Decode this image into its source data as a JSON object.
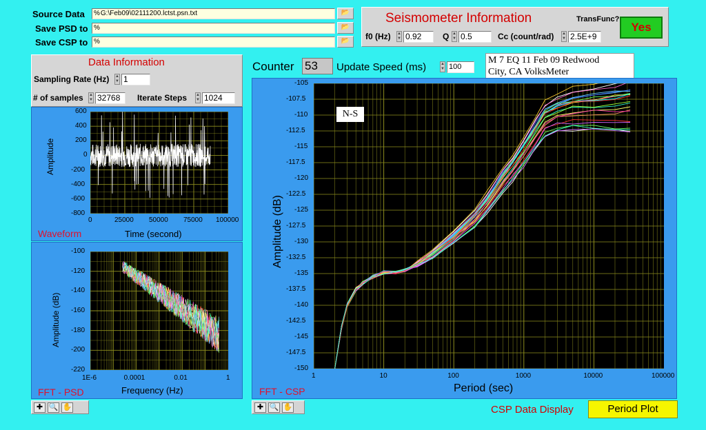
{
  "files": {
    "source": {
      "label": "Source Data",
      "value": "G:\\Feb09\\02111200.lctst.psn.txt"
    },
    "psd": {
      "label": "Save PSD to",
      "value": ""
    },
    "csp": {
      "label": "Save CSP to",
      "value": ""
    },
    "path_glyph": "%"
  },
  "seismometer": {
    "title": "Seismometer Information",
    "transfunc_label": "TransFunc?",
    "transfunc_value": "Yes",
    "f0_label": "f0 (Hz)",
    "f0_value": "0.92",
    "q_label": "Q",
    "q_value": "0.5",
    "cc_label": "Cc (count/rad)",
    "cc_value": "2.5E+9"
  },
  "data_info": {
    "title": "Data Information",
    "sampling_rate_label": "Sampling Rate (Hz)",
    "sampling_rate_value": "1",
    "samples_label": "# of samples",
    "samples_value": "32768",
    "iterate_label": "Iterate Steps",
    "iterate_value": "1024"
  },
  "counter": {
    "label": "Counter",
    "value": "53"
  },
  "update_speed": {
    "label": "Update Speed (ms)",
    "value": "100"
  },
  "event_note": {
    "line1": "M 7 EQ 11 Feb 09 Redwood",
    "line2": "City, CA VolksMeter"
  },
  "colors": {
    "accent_red": "#d40000",
    "chart_panel": "#3a9bee",
    "grid": "#8f8f1e",
    "trace": "#ffffff",
    "background": "#33f0f0",
    "yes_green": "#22cc22"
  },
  "bottom": {
    "csp_label": "CSP Data Display",
    "period_plot": "Period Plot"
  },
  "icons": [
    "folder-icon",
    "crosshair-icon",
    "zoom-icon",
    "hand-icon"
  ],
  "chart_data": [
    {
      "type": "line",
      "tag": "Waveform",
      "xlabel": "Time (second)",
      "ylabel": "Amplitude",
      "xlim": [
        0,
        100000
      ],
      "ylim": [
        -800,
        600
      ],
      "xticks": [
        "0",
        "25000",
        "50000",
        "75000",
        "100000"
      ],
      "yticks": [
        "600",
        "400",
        "200",
        "0",
        "-200",
        "-400",
        "-600",
        "-800"
      ],
      "x_data_extent": [
        0,
        87000
      ],
      "series": [
        {
          "values_note_range": [
            -300,
            300
          ]
        }
      ],
      "grid": true
    },
    {
      "type": "line",
      "tag": "FFT - PSD",
      "xlabel": "Frequency (Hz)",
      "ylabel": "Amplitude (dB)",
      "xscale": "log",
      "xlim": [
        1e-06,
        1
      ],
      "ylim": [
        -220,
        -100
      ],
      "xticks": [
        "1E-6",
        "0.0001",
        "0.01",
        "1"
      ],
      "yticks": [
        "-100",
        "-120",
        "-140",
        "-160",
        "-180",
        "-200",
        "-220"
      ],
      "grid": true
    },
    {
      "type": "line",
      "tag": "FFT - CSP",
      "annotation": "N-S",
      "xlabel": "Period (sec)",
      "ylabel": "Amplitude (dB)",
      "xscale": "log",
      "xlim": [
        1,
        100000
      ],
      "ylim": [
        -150,
        -105
      ],
      "xticks": [
        "1",
        "10",
        "100",
        "1000",
        "10000",
        "100000"
      ],
      "yticks": [
        "-105",
        "-107.5",
        "-110",
        "-112.5",
        "-115",
        "-117.5",
        "-120",
        "-122.5",
        "-125",
        "-127.5",
        "-130",
        "-132.5",
        "-135",
        "-137.5",
        "-140",
        "-142.5",
        "-145",
        "-147.5",
        "-150"
      ],
      "grid": true,
      "mean_curve": {
        "x": [
          2,
          2.5,
          3,
          4,
          5,
          7,
          10,
          15,
          20,
          30,
          50,
          100,
          200,
          300,
          500,
          700,
          1000,
          1500,
          2000,
          3000,
          5000,
          10000,
          20000,
          33000
        ],
        "y": [
          -150,
          -143.5,
          -140,
          -137.5,
          -136.5,
          -135.5,
          -134.8,
          -134.8,
          -134.5,
          -133.5,
          -132,
          -129.5,
          -126.5,
          -124,
          -120.5,
          -118.5,
          -116,
          -113,
          -111,
          -110,
          -109.5,
          -109.2,
          -109,
          -108.8
        ]
      }
    }
  ]
}
